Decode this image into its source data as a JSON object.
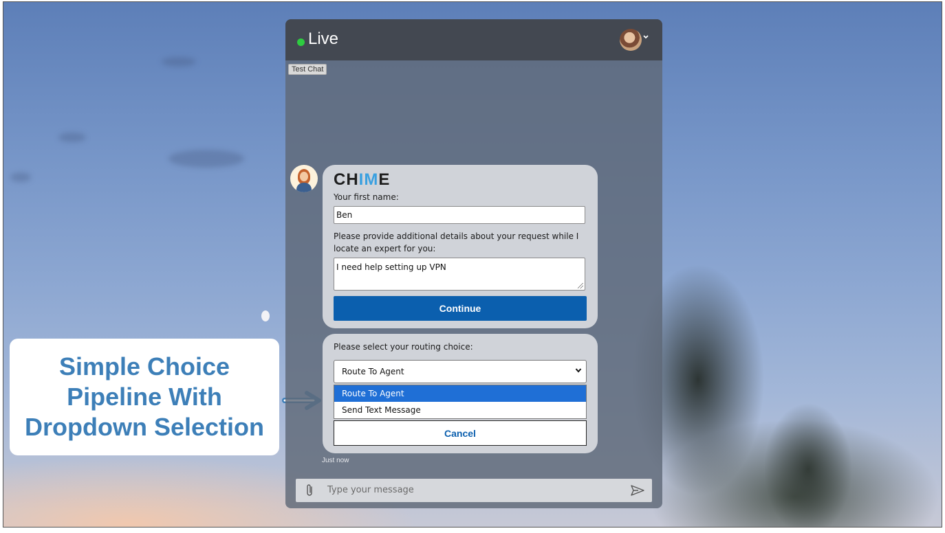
{
  "callout": {
    "text": "Simple Choice\nPipeline With\nDropdown Selection"
  },
  "header": {
    "status": "Live"
  },
  "badge": {
    "label": "Test Chat"
  },
  "form1": {
    "logo_part1": "CH",
    "logo_part2": "IM",
    "logo_part3": "E",
    "first_name_label": "Your first name:",
    "first_name_value": "Ben",
    "details_label": "Please provide additional details about your request while I locate an expert for you:",
    "details_value": "I need help setting up VPN",
    "continue_label": "Continue"
  },
  "form2": {
    "routing_label": "Please select your routing choice:",
    "selected_value": "Route To Agent",
    "options": [
      "Route To Agent",
      "Send Text Message"
    ],
    "cancel_label": "Cancel"
  },
  "timestamp": "Just now",
  "composer": {
    "placeholder": "Type your message"
  },
  "colors": {
    "primary": "#0b5fae",
    "live_dot": "#2ecc40",
    "callout_text": "#3d7fb8",
    "selected_option": "#1f6fd6"
  }
}
